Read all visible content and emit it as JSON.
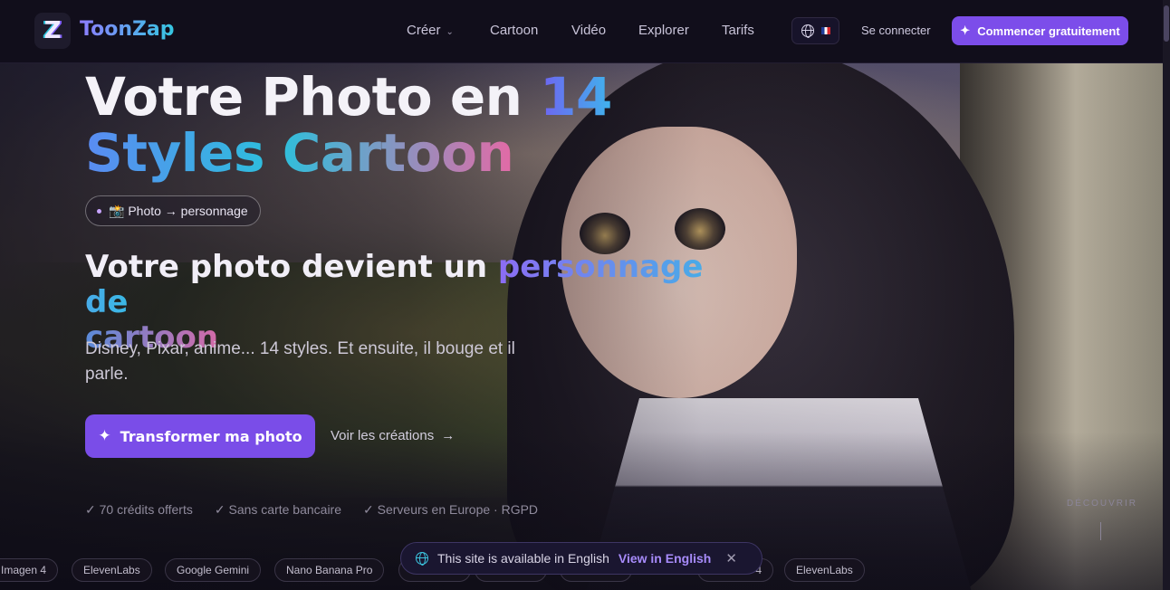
{
  "nav": {
    "brand": "ToonZap",
    "logo_letter": "Z",
    "links": [
      {
        "label": "Créer",
        "has_dropdown": true
      },
      {
        "label": "Cartoon"
      },
      {
        "label": "Vidéo"
      },
      {
        "label": "Explorer"
      },
      {
        "label": "Tarifs"
      }
    ],
    "language_icon": "globe-icon",
    "language_flag": "fr-flag",
    "signin_label": "Se connecter",
    "cta_label": "Commencer gratuitement"
  },
  "hero": {
    "title_line1_plain": "Votre Photo en ",
    "title_line1_accent": "14",
    "title_line2": "Styles Cartoon",
    "chip_label": "📸 Photo → personnage",
    "subtitle_plain": "Votre photo devient un ",
    "subtitle_accent1": "personnage de",
    "subtitle_accent2": "cartoon",
    "description": "Disney, Pixar, anime... 14 styles. Et ensuite, il bouge et il parle.",
    "primary_cta": "Transformer ma photo",
    "secondary_cta": "Voir les créations",
    "perks": [
      "✓ 70 crédits offerts",
      "✓ Sans carte bancaire",
      "✓ Serveurs en Europe · RGPD"
    ],
    "discover_label": "DÉCOUVRIR"
  },
  "marquee": {
    "tags": [
      "Imagen 4",
      "ElevenLabs",
      "Google Gemini",
      "Nano Banana Pro",
      "",
      "",
      "",
      "4",
      "ElevenLabs"
    ]
  },
  "toast": {
    "message": "This site is available in English",
    "link_label": "View in English",
    "close_symbol": "✕"
  },
  "colors": {
    "accent": "#7a4de8",
    "nav_bg": "#110e1b",
    "gradient_cyan": "#3fb4ec",
    "gradient_pink": "#e36aa6"
  }
}
